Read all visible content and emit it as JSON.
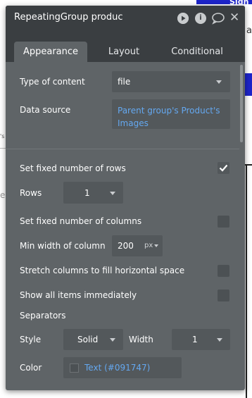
{
  "background": {
    "signup_text": "Sign",
    "side_letter": "a",
    "left_fragment_top": "'s",
    "left_fragment_mid": "e"
  },
  "panel": {
    "title": "RepeatingGroup produc",
    "title_icons": [
      "play-icon",
      "info-icon",
      "comment-icon",
      "close-icon"
    ],
    "info_glyph": "i",
    "close_glyph": "✕",
    "tabs": [
      {
        "label": "Appearance",
        "active": true
      },
      {
        "label": "Layout",
        "active": false
      },
      {
        "label": "Conditional",
        "active": false
      }
    ]
  },
  "fields": {
    "type_of_content": {
      "label": "Type of content",
      "value": "file"
    },
    "data_source": {
      "label": "Data source",
      "value": "Parent group's Product's Images"
    },
    "fixed_rows": {
      "label": "Set fixed number of rows",
      "checked": true
    },
    "rows": {
      "label": "Rows",
      "value": "1"
    },
    "fixed_columns": {
      "label": "Set fixed number of columns",
      "checked": false
    },
    "min_width": {
      "label": "Min width of column",
      "value": "200",
      "unit": "px"
    },
    "stretch": {
      "label": "Stretch columns to fill horizontal space",
      "checked": false
    },
    "show_all": {
      "label": "Show all items immediately",
      "checked": false
    },
    "separators": {
      "heading": "Separators"
    },
    "style": {
      "label": "Style",
      "value": "Solid"
    },
    "width": {
      "label": "Width",
      "value": "1"
    },
    "color": {
      "label": "Color",
      "value": "Text (#091747)",
      "swatch": "#091747"
    }
  },
  "colors": {
    "panel_bg": "#5f6467",
    "header_bg": "#3a3e41",
    "link": "#64a8f0",
    "accent_blue": "#1d24c9"
  }
}
